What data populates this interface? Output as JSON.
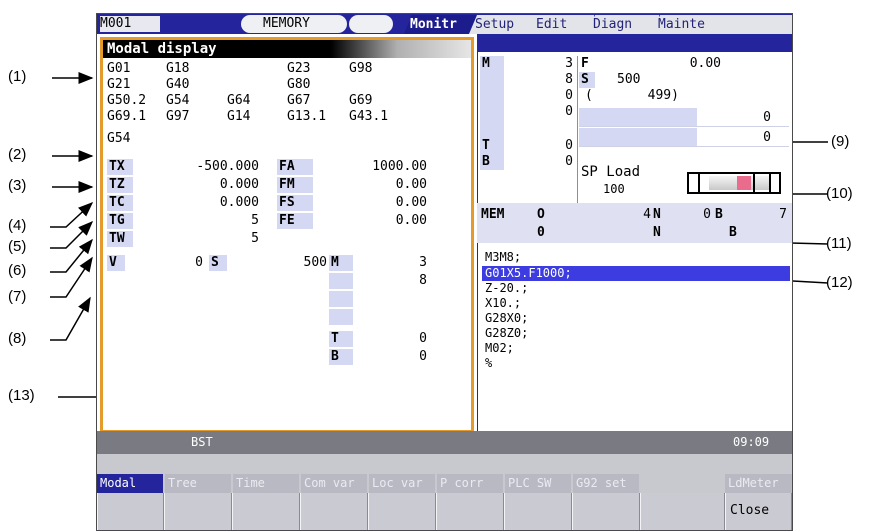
{
  "callouts": [
    "(1)",
    "(2)",
    "(3)",
    "(4)",
    "(5)",
    "(6)",
    "(7)",
    "(8)",
    "(9)",
    "(10)",
    "(11)",
    "(12)",
    "(13)"
  ],
  "topbar": {
    "screen_id": "M001",
    "mode": "MEMORY",
    "tabs": [
      {
        "label": "Monitr",
        "active": true
      },
      {
        "label": "Setup",
        "active": false
      },
      {
        "label": "Edit",
        "active": false
      },
      {
        "label": "Diagn",
        "active": false
      },
      {
        "label": "Mainte",
        "active": false
      }
    ]
  },
  "modal": {
    "title": "Modal display",
    "gcode_rows": [
      [
        "G01",
        "G18",
        "",
        "G23",
        "G98"
      ],
      [
        "G21",
        "G40",
        "",
        "G80",
        ""
      ],
      [
        "G50.2",
        "G54",
        "G64",
        "G67",
        "G69"
      ],
      [
        "G69.1",
        "G97",
        "G14",
        "G13.1",
        "G43.1"
      ]
    ],
    "work_offset": "G54",
    "axes": [
      {
        "label": "TX",
        "value": "-500.000"
      },
      {
        "label": "TZ",
        "value": "0.000"
      },
      {
        "label": "TC",
        "value": "0.000"
      },
      {
        "label": "TG",
        "value": "5"
      },
      {
        "label": "TW",
        "value": "5"
      }
    ],
    "feeds": [
      {
        "label": "FA",
        "value": "1000.00"
      },
      {
        "label": "FM",
        "value": "0.00"
      },
      {
        "label": "FS",
        "value": "0.00"
      },
      {
        "label": "FE",
        "value": "0.00"
      }
    ],
    "v_label": "V",
    "v_value": "0",
    "s_label": "S",
    "s_value": "500",
    "m_label": "M",
    "m_values": [
      "3",
      "8"
    ],
    "t_label": "T",
    "t_value": "0",
    "b_label": "B",
    "b_value": "0"
  },
  "right": {
    "m_label": "M",
    "m_values": [
      "3",
      "8",
      "0",
      "0"
    ],
    "t_label": "T",
    "t_value": "0",
    "b_label": "B",
    "b_value": "0",
    "f_label": "F",
    "f_value": "0.00",
    "s_label": "S",
    "s_value": "500",
    "s_actual": "(       499)",
    "r1_value": "0",
    "r2_value": "0",
    "sp_load_label": "SP Load",
    "sp_load_value": "100",
    "mem_label": "MEM",
    "o_label": "O",
    "o_value": "4",
    "n_label": "N",
    "n_value": "0",
    "b2_label": "B",
    "b2_value": "7",
    "row2_o_value": "0",
    "row2_n_label": "N",
    "row2_b_label": "B",
    "program": [
      "M3M8;",
      "G01X5.F1000;",
      "Z-20.;",
      "X10.;",
      "G28X0;",
      "G28Z0;",
      "M02;",
      "%"
    ],
    "highlight_line": 1
  },
  "status": {
    "left": "BST",
    "time": "09:09"
  },
  "menu": {
    "items": [
      {
        "label": "Modal",
        "active": true
      },
      {
        "label": "Tree",
        "active": false
      },
      {
        "label": "Time",
        "active": false
      },
      {
        "label": "Com var",
        "active": false
      },
      {
        "label": "Loc var",
        "active": false
      },
      {
        "label": "P corr",
        "active": false
      },
      {
        "label": "PLC SW",
        "active": false
      },
      {
        "label": "G92 set",
        "active": false
      },
      {
        "label": "",
        "active": false
      },
      {
        "label": "LdMeter",
        "active": false
      }
    ],
    "close_label": "Close"
  },
  "colors": {
    "accent_blue": "#24249c",
    "panel_border": "#e59a2c",
    "label_bg": "#d4d8f2",
    "status_bar": "#7a7a82",
    "highlight": "#3c3ce0"
  }
}
